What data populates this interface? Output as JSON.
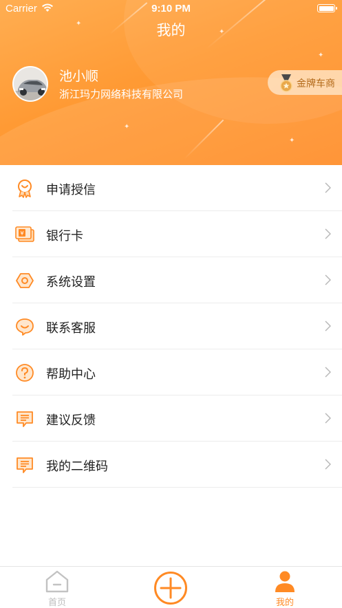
{
  "status_bar": {
    "carrier": "Carrier",
    "time": "9:10 PM"
  },
  "nav": {
    "title": "我的"
  },
  "profile": {
    "name": "池小顺",
    "company": "浙江玛力网络科技有限公司",
    "badge": "金牌车商"
  },
  "menu": [
    {
      "label": "申请授信",
      "icon": "ribbon-icon"
    },
    {
      "label": "银行卡",
      "icon": "bank-card-icon"
    },
    {
      "label": "系统设置",
      "icon": "settings-icon"
    },
    {
      "label": "联系客服",
      "icon": "customer-service-icon"
    },
    {
      "label": "帮助中心",
      "icon": "help-icon"
    },
    {
      "label": "建议反馈",
      "icon": "feedback-icon"
    },
    {
      "label": "我的二维码",
      "icon": "qrcode-message-icon"
    }
  ],
  "tabbar": {
    "home": "首页",
    "mine": "我的"
  },
  "colors": {
    "accent": "#ff8a24",
    "header_top": "#ffae52",
    "header_bottom": "#ff8a22"
  }
}
